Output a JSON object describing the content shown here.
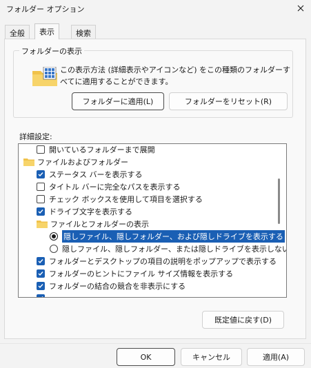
{
  "window": {
    "title": "フォルダー オプション"
  },
  "tabs": [
    {
      "label": "全般"
    },
    {
      "label": "表示"
    },
    {
      "label": "検索"
    }
  ],
  "folder_view": {
    "legend": "フォルダーの表示",
    "description": "この表示方法 (詳細表示やアイコンなど) をこの種類のフォルダーすべてに適用することができます。",
    "apply_button": "フォルダーに適用(L)",
    "reset_button": "フォルダーをリセット(R)"
  },
  "advanced": {
    "label": "詳細設定:",
    "items": [
      {
        "type": "checkbox",
        "checked": false,
        "label": "開いているフォルダーまで展開"
      },
      {
        "type": "folder",
        "label": "ファイルおよびフォルダー"
      },
      {
        "type": "checkbox",
        "checked": true,
        "label": "ステータス バーを表示する"
      },
      {
        "type": "checkbox",
        "checked": false,
        "label": "タイトル バーに完全なパスを表示する"
      },
      {
        "type": "checkbox",
        "checked": false,
        "label": "チェック ボックスを使用して項目を選択する"
      },
      {
        "type": "checkbox",
        "checked": true,
        "label": "ドライブ文字を表示する"
      },
      {
        "type": "folder",
        "label": "ファイルとフォルダーの表示"
      },
      {
        "type": "radio",
        "checked": true,
        "selected": true,
        "label": "隠しファイル、隠しフォルダー、および隠しドライブを表示する"
      },
      {
        "type": "radio",
        "checked": false,
        "label": "隠しファイル、隠しフォルダー、または隠しドライブを表示しない"
      },
      {
        "type": "checkbox",
        "checked": true,
        "label": "フォルダーとデスクトップの項目の説明をポップアップで表示する"
      },
      {
        "type": "checkbox",
        "checked": true,
        "label": "フォルダーのヒントにファイル サイズ情報を表示する"
      },
      {
        "type": "checkbox",
        "checked": true,
        "label": "フォルダーの結合の競合を非表示にする"
      }
    ]
  },
  "defaults_button": "既定値に戻す(D)",
  "footer": {
    "ok": "OK",
    "cancel": "キャンセル",
    "apply": "適用(A)"
  }
}
